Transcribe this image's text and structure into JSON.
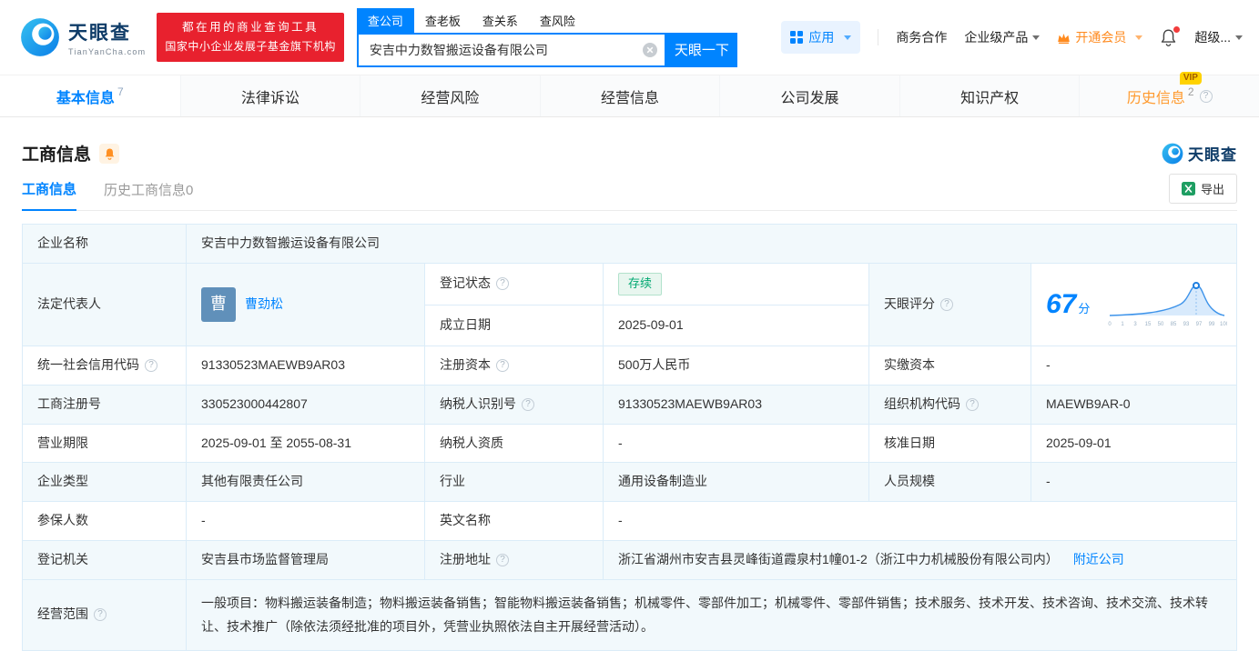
{
  "header": {
    "brand": "天眼查",
    "brand_domain": "TianYanCha.com",
    "promo_line1": "都在用的商业查询工具",
    "promo_line2": "国家中小企业发展子基金旗下机构",
    "search_tabs": [
      {
        "label": "查公司"
      },
      {
        "label": "查老板"
      },
      {
        "label": "查关系"
      },
      {
        "label": "查风险"
      }
    ],
    "search_value": "安吉中力数智搬运设备有限公司",
    "search_button": "天眼一下",
    "menu_apps": "应用",
    "menu_cooperation": "商务合作",
    "menu_enterprise": "企业级产品",
    "menu_vip": "开通会员",
    "menu_user": "超级..."
  },
  "nav": {
    "tabs": [
      {
        "label": "基本信息",
        "count": "7"
      },
      {
        "label": "法律诉讼"
      },
      {
        "label": "经营风险"
      },
      {
        "label": "经营信息"
      },
      {
        "label": "公司发展"
      },
      {
        "label": "知识产权"
      },
      {
        "label": "历史信息",
        "count": "2",
        "badge": "VIP"
      }
    ]
  },
  "section": {
    "title": "工商信息",
    "logo_text": "天眼查",
    "tab_active": "工商信息",
    "tab_history": "历史工商信息0",
    "export_label": "导出"
  },
  "info": {
    "company_name_label": "企业名称",
    "company_name": "安吉中力数智搬运设备有限公司",
    "legal_rep_label": "法定代表人",
    "legal_rep_avatar": "曹",
    "legal_rep_name": "曹劲松",
    "reg_status_label": "登记状态",
    "reg_status": "存续",
    "establish_label": "成立日期",
    "establish_date": "2025-09-01",
    "score_label": "天眼评分",
    "score_value": "67",
    "score_unit": "分",
    "score_ticks": [
      "0",
      "1",
      "3",
      "15",
      "50",
      "85",
      "93",
      "97",
      "99",
      "100"
    ],
    "credit_code_label": "统一社会信用代码",
    "credit_code": "91330523MAEWB9AR03",
    "reg_capital_label": "注册资本",
    "reg_capital": "500万人民币",
    "paid_capital_label": "实缴资本",
    "paid_capital": "-",
    "reg_number_label": "工商注册号",
    "reg_number": "330523000442807",
    "taxpayer_id_label": "纳税人识别号",
    "taxpayer_id": "91330523MAEWB9AR03",
    "org_code_label": "组织机构代码",
    "org_code": "MAEWB9AR-0",
    "business_term_label": "营业期限",
    "business_term": "2025-09-01 至 2055-08-31",
    "taxpayer_quality_label": "纳税人资质",
    "taxpayer_quality": "-",
    "approval_date_label": "核准日期",
    "approval_date": "2025-09-01",
    "company_type_label": "企业类型",
    "company_type": "其他有限责任公司",
    "industry_label": "行业",
    "industry": "通用设备制造业",
    "staff_size_label": "人员规模",
    "staff_size": "-",
    "insured_label": "参保人数",
    "insured": "-",
    "english_name_label": "英文名称",
    "english_name": "-",
    "reg_authority_label": "登记机关",
    "reg_authority": "安吉县市场监督管理局",
    "address_label": "注册地址",
    "address": "浙江省湖州市安吉县灵峰街道霞泉村1幢01-2（浙江中力机械股份有限公司内）",
    "nearby_link": "附近公司",
    "business_scope_label": "经营范围",
    "business_scope": "一般项目：物料搬运装备制造；物料搬运装备销售；智能物料搬运装备销售；机械零件、零部件加工；机械零件、零部件销售；技术服务、技术开发、技术咨询、技术交流、技术转让、技术推广（除依法须经批准的项目外，凭营业执照依法自主开展经营活动）。"
  }
}
